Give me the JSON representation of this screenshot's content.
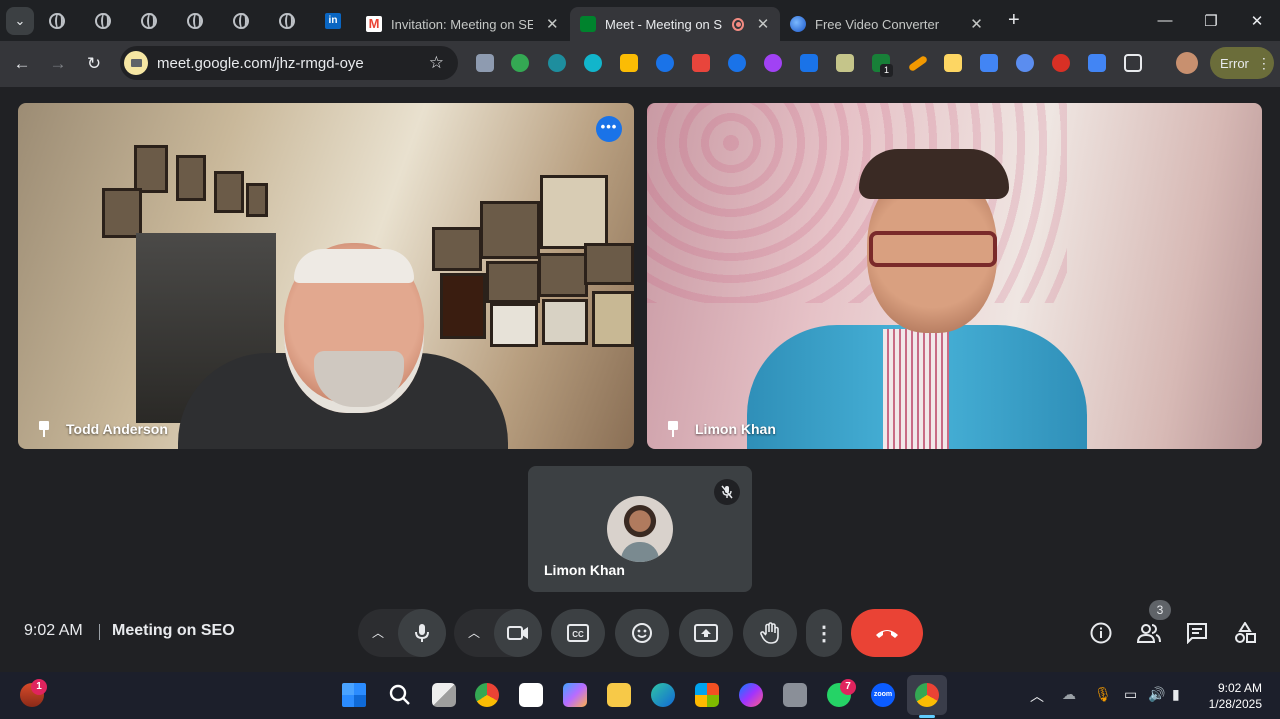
{
  "browser": {
    "tabs": [
      {
        "title": "Invitation: Meeting on SEO"
      },
      {
        "title": "Meet - Meeting on SEO"
      },
      {
        "title": "Free Video Converter"
      }
    ],
    "url": "meet.google.com/jhz-rmgd-oye",
    "extension_badge": "1",
    "error_label": "Error"
  },
  "participants": {
    "left": {
      "name": "Todd Anderson"
    },
    "right": {
      "name": "Limon Khan"
    },
    "self": {
      "name": "Limon Khan"
    }
  },
  "controls": {
    "time": "9:02 AM",
    "meeting_name": "Meeting on SEO",
    "people_count": "3"
  },
  "taskbar": {
    "widget_badge": "1",
    "whatsapp_badge": "7",
    "zoom_label": "zoom",
    "time": "9:02 AM",
    "date": "1/28/2025"
  },
  "colors": {
    "end_call": "#ea4335",
    "more_options": "#1a73e8",
    "meet_bg": "#202124"
  }
}
